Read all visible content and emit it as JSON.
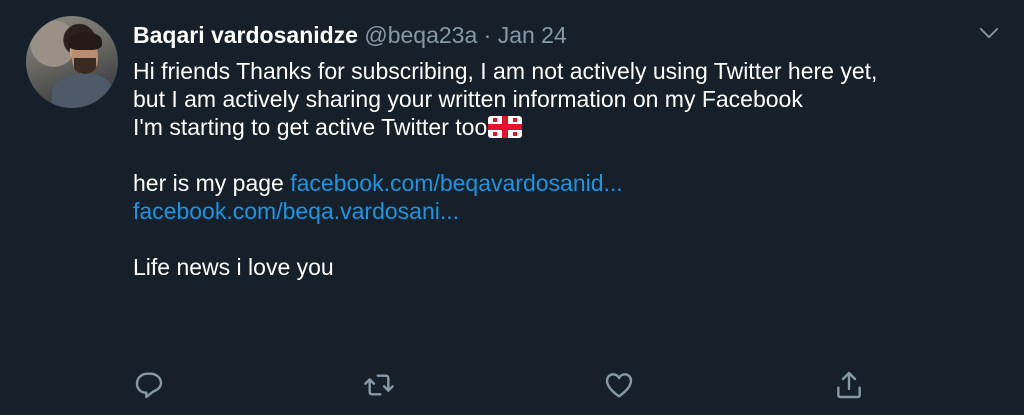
{
  "tweet": {
    "author_name": "Baqari vardosanidze",
    "handle": "@beqa23a",
    "separator": "·",
    "date": "Jan 24",
    "lines": {
      "l1": "Hi friends Thanks for subscribing, I am not actively using Twitter here yet,",
      "l2": "but I am actively sharing your written information on my  Facebook",
      "l3": "I'm starting to get active  Twitter too",
      "l5_text": "her is my page ",
      "l5_link": "facebook.com/beqavardosanid...",
      "l6_link": "facebook.com/beqa.vardosani...",
      "l8": "Life news i love you"
    },
    "flag_icon": "georgia-flag-emoji"
  },
  "icons": {
    "menu": "chevron-down-icon",
    "reply": "reply-icon",
    "retweet": "retweet-icon",
    "like": "heart-icon",
    "share": "share-icon"
  },
  "colors": {
    "background": "#15202b",
    "text": "#ffffff",
    "secondary": "#8899a6",
    "link": "#1b95e0"
  }
}
